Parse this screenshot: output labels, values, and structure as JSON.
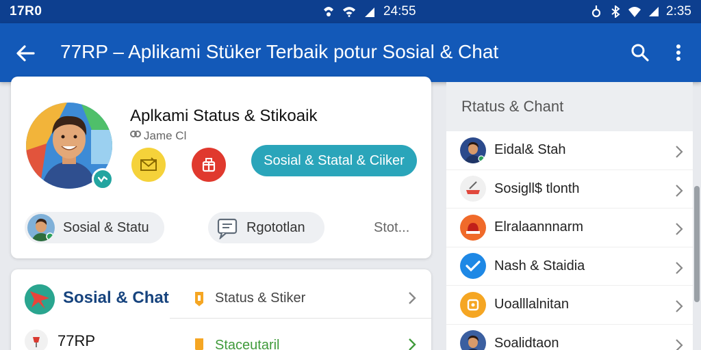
{
  "status_bar": {
    "left_text": "17R0",
    "center_time": "24:55",
    "right_time": "2:35"
  },
  "app_bar": {
    "title": "77RP – Aplikami Stüker Terbaik potur Sosial & Chat",
    "icons": [
      "back-arrow-icon",
      "search-icon",
      "more-vert-icon"
    ]
  },
  "profile": {
    "title": "Aplkami Status & Stikoaik",
    "subtitle": "Jame Cl",
    "action_pill": "Sosial & Statal & Ciiker",
    "chips": [
      {
        "label": "Sosial & Statu"
      },
      {
        "label": "Rgototlan"
      }
    ],
    "more_label": "Stot..."
  },
  "list_card": {
    "title": "Sosial & Chat",
    "subtitle": "77RP",
    "rows": [
      {
        "label": "Status & Stiker"
      },
      {
        "label": "Staceutaril"
      }
    ]
  },
  "side_panel": {
    "header": "Rtatus & Chant",
    "items": [
      {
        "label": "Eidal& Stah",
        "icon_color": "#2b4a8c"
      },
      {
        "label": "Sosigll$ tlonth",
        "icon_color": "#f0f0f0"
      },
      {
        "label": "Elralaannnarm",
        "icon_color": "#f06a2a"
      },
      {
        "label": "Nash & Staidia",
        "icon_color": "#1e88e5"
      },
      {
        "label": "Uoalllalnitan",
        "icon_color": "#f5a623"
      },
      {
        "label": "Soalidtaon",
        "icon_color": "#3b5fa0"
      }
    ]
  },
  "colors": {
    "status_bar": "#0d3f8f",
    "app_bar": "#1359b8",
    "accent_teal": "#2aa5ba",
    "list_title": "#17447e"
  }
}
